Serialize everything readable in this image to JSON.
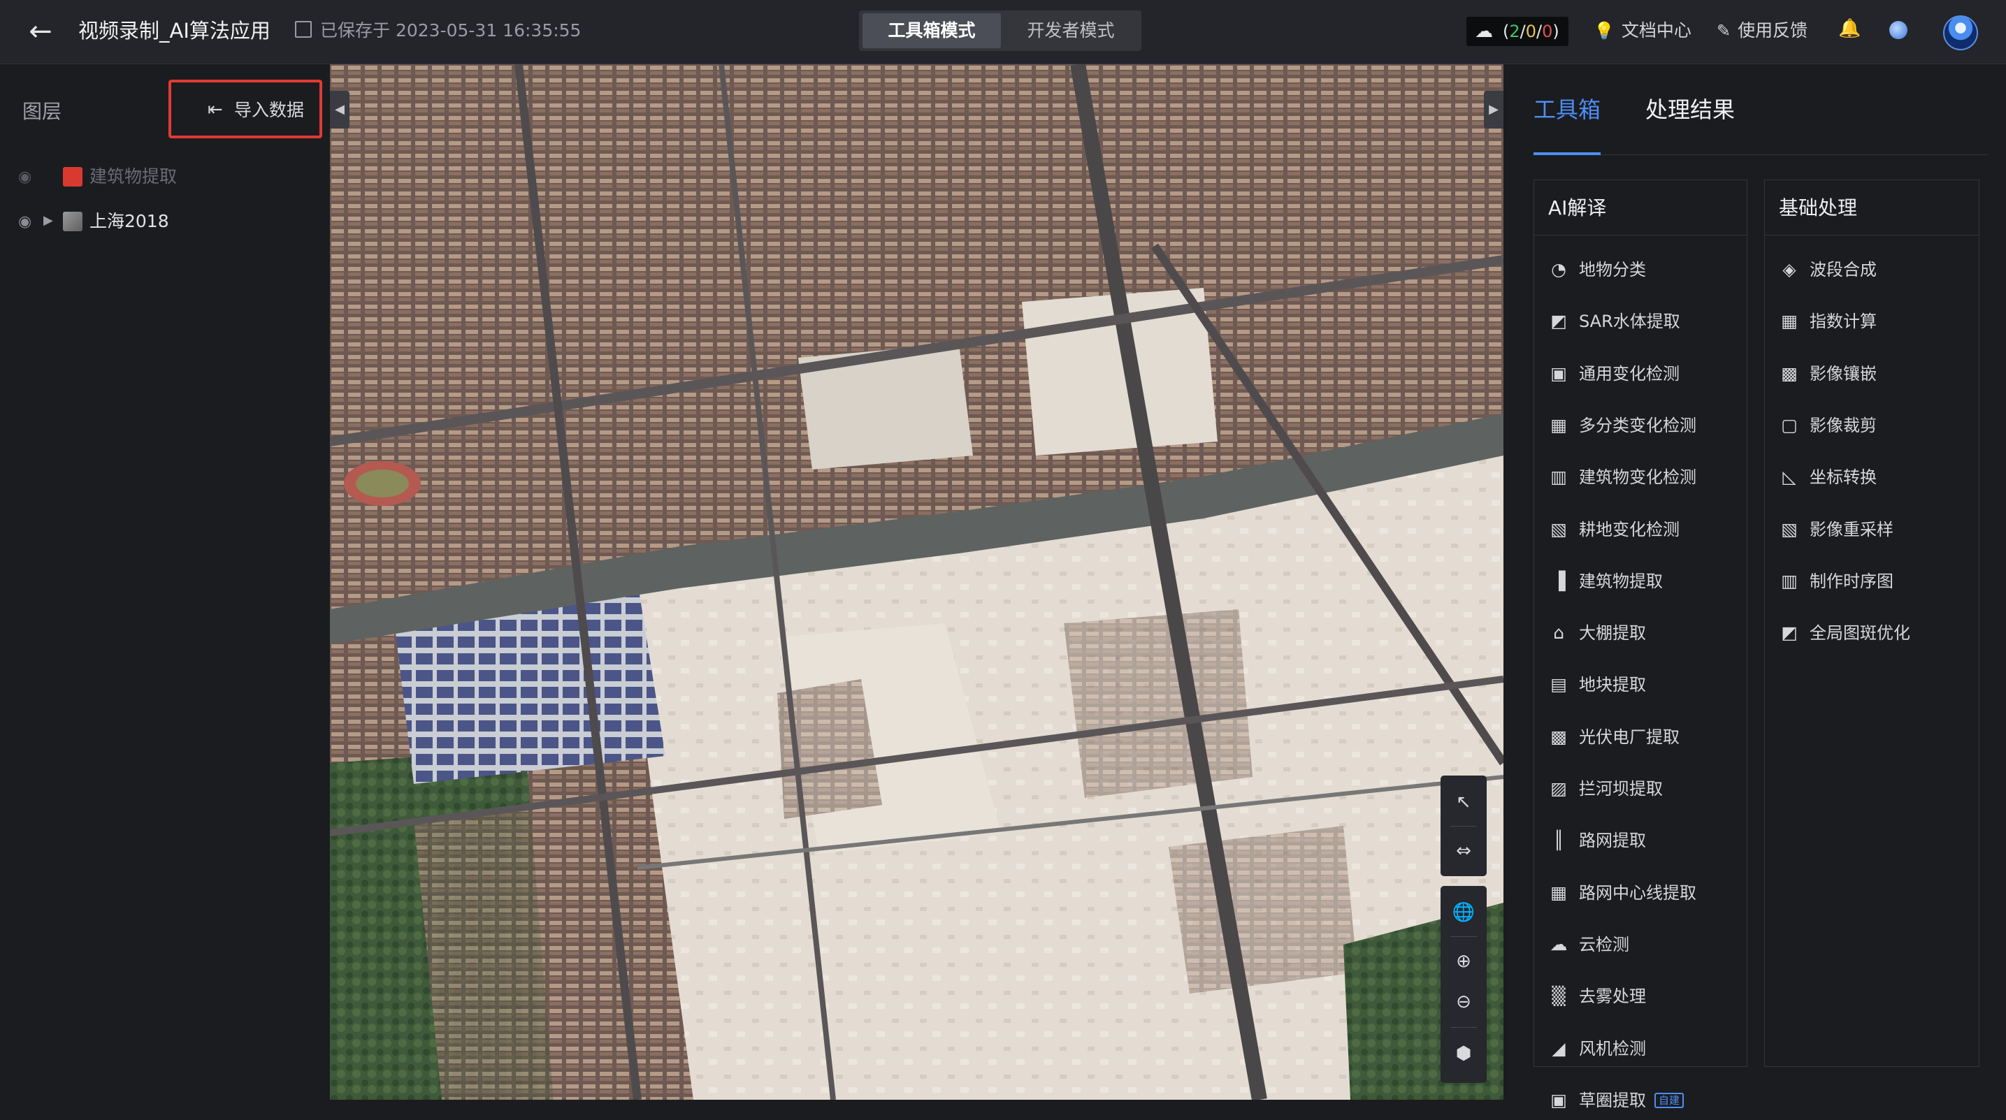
{
  "header": {
    "back_icon": "arrow-left-icon",
    "title": "视频录制_AI算法应用",
    "saved_text": "已保存于 2023-05-31 16:35:55",
    "modes": [
      {
        "label": "工具箱模式",
        "active": true
      },
      {
        "label": "开发者模式",
        "active": false
      }
    ],
    "task_counter": {
      "open": "(",
      "done": "2",
      "sep1": "/",
      "running": "0",
      "sep2": "/",
      "failed": "0",
      "close": ")"
    },
    "doc_center": "文档中心",
    "feedback": "使用反馈"
  },
  "layers_panel": {
    "title": "图层",
    "import_label": "导入数据",
    "layers": [
      {
        "name": "建筑物提取",
        "visible": false,
        "color": "#d93a2f",
        "expandable": false
      },
      {
        "name": "上海2018",
        "visible": true,
        "color": "#777777",
        "expandable": true
      }
    ]
  },
  "map": {
    "tools": [
      "pointer-icon",
      "split-compare-icon",
      "globe-icon",
      "zoom-in-icon",
      "zoom-out-icon",
      "layers-3d-icon"
    ]
  },
  "right_panel": {
    "tabs": [
      {
        "label": "工具箱",
        "active": true
      },
      {
        "label": "处理结果",
        "active": false
      }
    ],
    "ai_group": {
      "title": "AI解译",
      "items": [
        {
          "label": "地物分类",
          "icon": "segment-icon"
        },
        {
          "label": "SAR水体提取",
          "icon": "sar-water-icon"
        },
        {
          "label": "通用变化检测",
          "icon": "change-detect-icon"
        },
        {
          "label": "多分类变化检测",
          "icon": "multi-change-icon"
        },
        {
          "label": "建筑物变化检测",
          "icon": "building-change-icon"
        },
        {
          "label": "耕地变化检测",
          "icon": "farmland-change-icon"
        },
        {
          "label": "建筑物提取",
          "icon": "building-icon"
        },
        {
          "label": "大棚提取",
          "icon": "greenhouse-icon"
        },
        {
          "label": "地块提取",
          "icon": "parcel-icon"
        },
        {
          "label": "光伏电厂提取",
          "icon": "solar-icon"
        },
        {
          "label": "拦河坝提取",
          "icon": "dam-icon"
        },
        {
          "label": "路网提取",
          "icon": "road-icon"
        },
        {
          "label": "路网中心线提取",
          "icon": "road-centerline-icon"
        },
        {
          "label": "云检测",
          "icon": "cloud-icon"
        },
        {
          "label": "去雾处理",
          "icon": "dehaze-icon"
        },
        {
          "label": "风机检测",
          "icon": "wind-turbine-icon"
        },
        {
          "label": "草圈提取",
          "icon": "grass-icon",
          "badge": "自建"
        }
      ]
    },
    "basic_group": {
      "title": "基础处理",
      "items": [
        {
          "label": "波段合成",
          "icon": "band-stack-icon"
        },
        {
          "label": "指数计算",
          "icon": "index-calc-icon"
        },
        {
          "label": "影像镶嵌",
          "icon": "mosaic-icon"
        },
        {
          "label": "影像裁剪",
          "icon": "crop-icon"
        },
        {
          "label": "坐标转换",
          "icon": "coordinate-icon"
        },
        {
          "label": "影像重采样",
          "icon": "resample-icon"
        },
        {
          "label": "制作时序图",
          "icon": "timeseries-icon"
        },
        {
          "label": "全局图斑优化",
          "icon": "optimize-icon"
        }
      ]
    }
  }
}
